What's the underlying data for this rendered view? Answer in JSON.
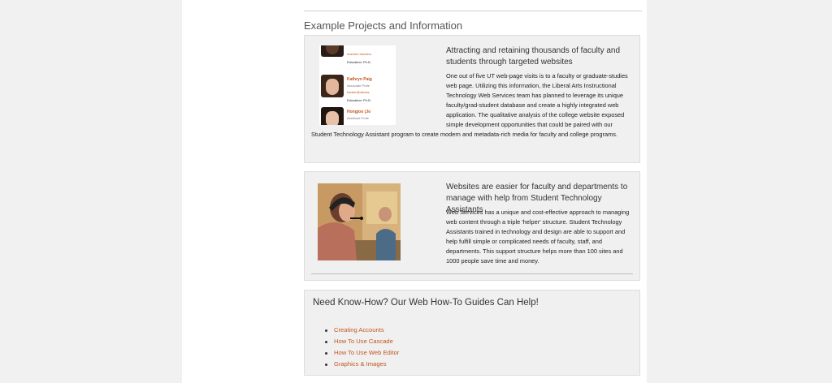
{
  "section": {
    "title": "Example Projects and Information"
  },
  "panel1": {
    "title": "Attracting and retaining thousands of faculty and students through targeted websites",
    "body_line_a": "One out of five UT web-page visits is to a faculty or graduate-studies web page. Utilizing this information, the Liberal Arts Instructional Technology Web Services team has planned to leverage its unique faculty/grad-student database and create a highly integrated web application. The qualitative analysis of the college website exposed simple development opportunities that could be paired with our",
    "body_line_b": "Student Technology Assistant program to create modern and metadata-rich media for faculty and college programs.",
    "thumbnail": {
      "p1_link": "marlone.henders",
      "p1_edu": "Education: Ph.D.",
      "p2_name": "Kathryn Paig",
      "p2_title": "Associate Profe",
      "p2_link": "harder@utexas.",
      "p2_edu": "Education: Ph.D.",
      "p3_name": "Hongjoo (Jo",
      "p3_title": "Assistant Profe"
    }
  },
  "panel2": {
    "title": "Websites are easier for faculty and departments to manage with help from Student Technology Assistants",
    "body": "Web Services has a unique and cost-effective approach to managing web content through a triple 'helper' structure. Student Technology Assistants trained in technology and design are able to support and help fulfill simple or complicated needs of faculty, staff, and departments. This support structure helps more than 100 sites and 1000 people save time and money."
  },
  "panel3": {
    "title": "Need Know-How? Our Web How-To Guides Can Help!",
    "links": [
      "Creating Accounts",
      "How To Use Cascade",
      "How To Use Web Editor",
      "Graphics & Images"
    ]
  },
  "colors": {
    "link": "#c4561f",
    "panel_bg": "#f0f0f0",
    "page_bg": "#f1f1f1"
  }
}
